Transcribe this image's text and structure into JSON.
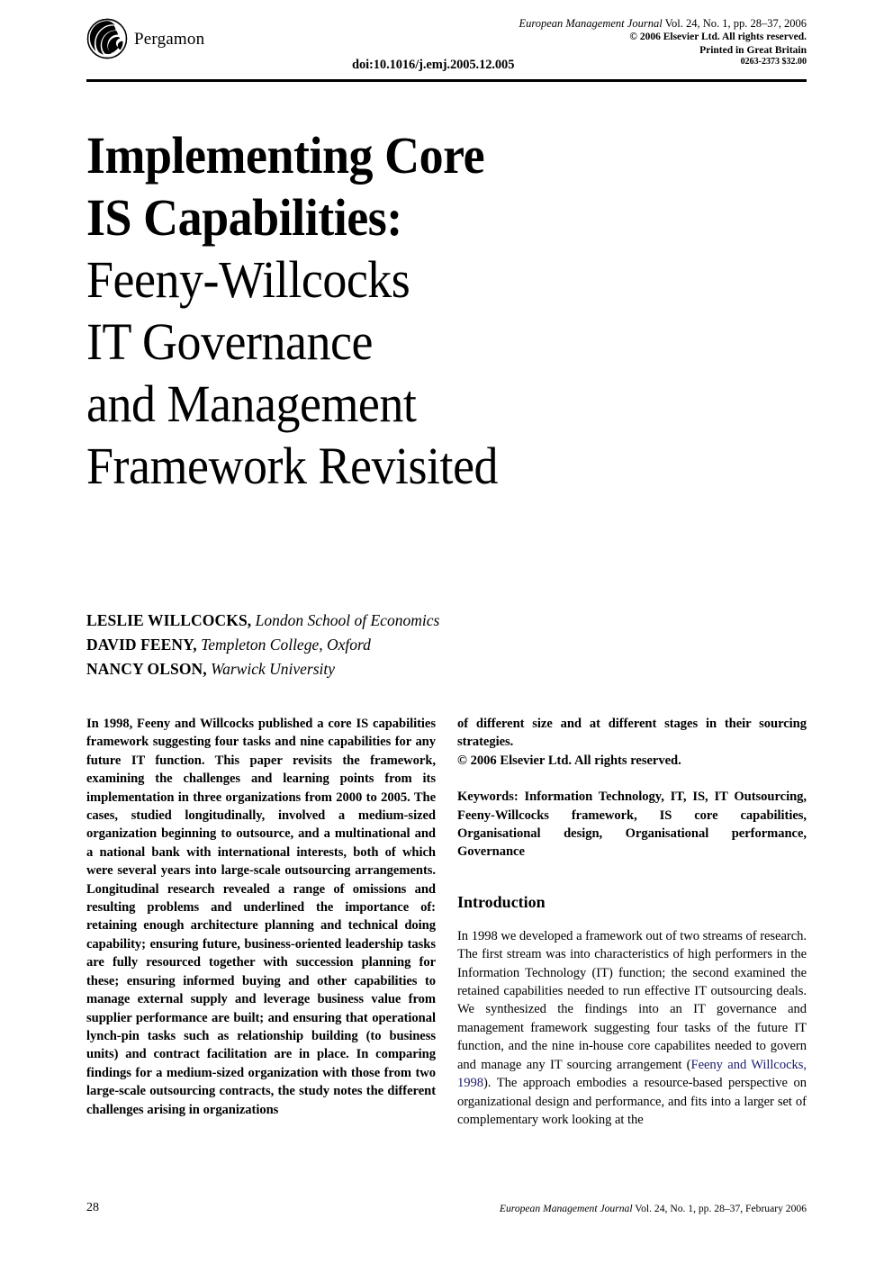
{
  "header": {
    "publisher_logo": "pergamon-logo",
    "publisher_name": "Pergamon",
    "journal_citation": "European Management Journal",
    "journal_citation_rest": " Vol. 24, No. 1, pp. 28–37, 2006",
    "copyright": "© 2006 Elsevier Ltd. All rights reserved.",
    "printed_in": "Printed in Great Britain",
    "issn_price": "0263-2373 $32.00",
    "doi": "doi:10.1016/j.emj.2005.12.005"
  },
  "title": {
    "lines": [
      "Implementing Core",
      "IS Capabilities:",
      "Feeny-Willcocks",
      "IT Governance",
      "and Management",
      "Framework Revisited"
    ]
  },
  "authors": [
    {
      "name": "LESLIE WILLCOCKS,",
      "affiliation": "London School of Economics"
    },
    {
      "name": "DAVID FEENY,",
      "affiliation": "Templeton College, Oxford"
    },
    {
      "name": "NANCY OLSON,",
      "affiliation": "Warwick University"
    }
  ],
  "abstract": {
    "part1": "In 1998, Feeny and Willcocks published a core IS capabilities framework suggesting four tasks and nine capabilities for any future IT function. This paper revisits the framework, examining the challenges and learning points from its implementation in three organizations from 2000 to 2005. The cases, studied longitudinally, involved a medium-sized organization beginning to outsource, and a multinational and a national bank with international interests, both of which were several years into large-scale outsourcing arrangements. Longitudinal research revealed a range of omissions and resulting problems and underlined the importance of: retaining enough architecture planning and technical doing capability; ensuring future, business-oriented leadership tasks are fully resourced together with succession planning for these; ensuring informed buying and other capabilities to manage external supply and leverage business value from supplier performance are built; and ensuring that operational lynch-pin tasks such as relationship building (to business units) and contract facilitation are in place. In comparing findings for a medium-sized organization with those from two large-scale outsourcing contracts, the study notes the different challenges arising in organizations",
    "part2": "of different size and at different stages in their sourcing strategies.",
    "copyright": "© 2006 Elsevier Ltd. All rights reserved."
  },
  "keywords": {
    "label": "Keywords:",
    "text": " Information Technology, IT, IS, IT Outsourcing, Feeny-Willcocks framework, IS core capabilities, Organisational design, Organisational performance, Governance"
  },
  "sections": {
    "introduction": {
      "heading": "Introduction",
      "para1_before": "In 1998 we developed a framework out of two streams of research. The first stream was into characteristics of high performers in the Information Technology (IT) function; the second examined the retained capabilities needed to run effective IT outsourcing deals. We synthesized the findings into an IT governance and management framework suggesting four tasks of the future IT function, and the nine in-house core capabilites needed to govern and manage any IT sourcing arrangement (",
      "citation": "Feeny and Willcocks, 1998",
      "para1_after": "). The approach embodies a resource-based perspective on organizational design and performance, and fits into a larger set of complementary work looking at the"
    }
  },
  "footer": {
    "page_number": "28",
    "journal_name": "European Management Journal",
    "journal_rest": " Vol. 24, No. 1, pp. 28–37, February 2006"
  },
  "colors": {
    "text": "#000000",
    "citation_link": "#1b1b6b",
    "page_background": "#ffffff"
  }
}
